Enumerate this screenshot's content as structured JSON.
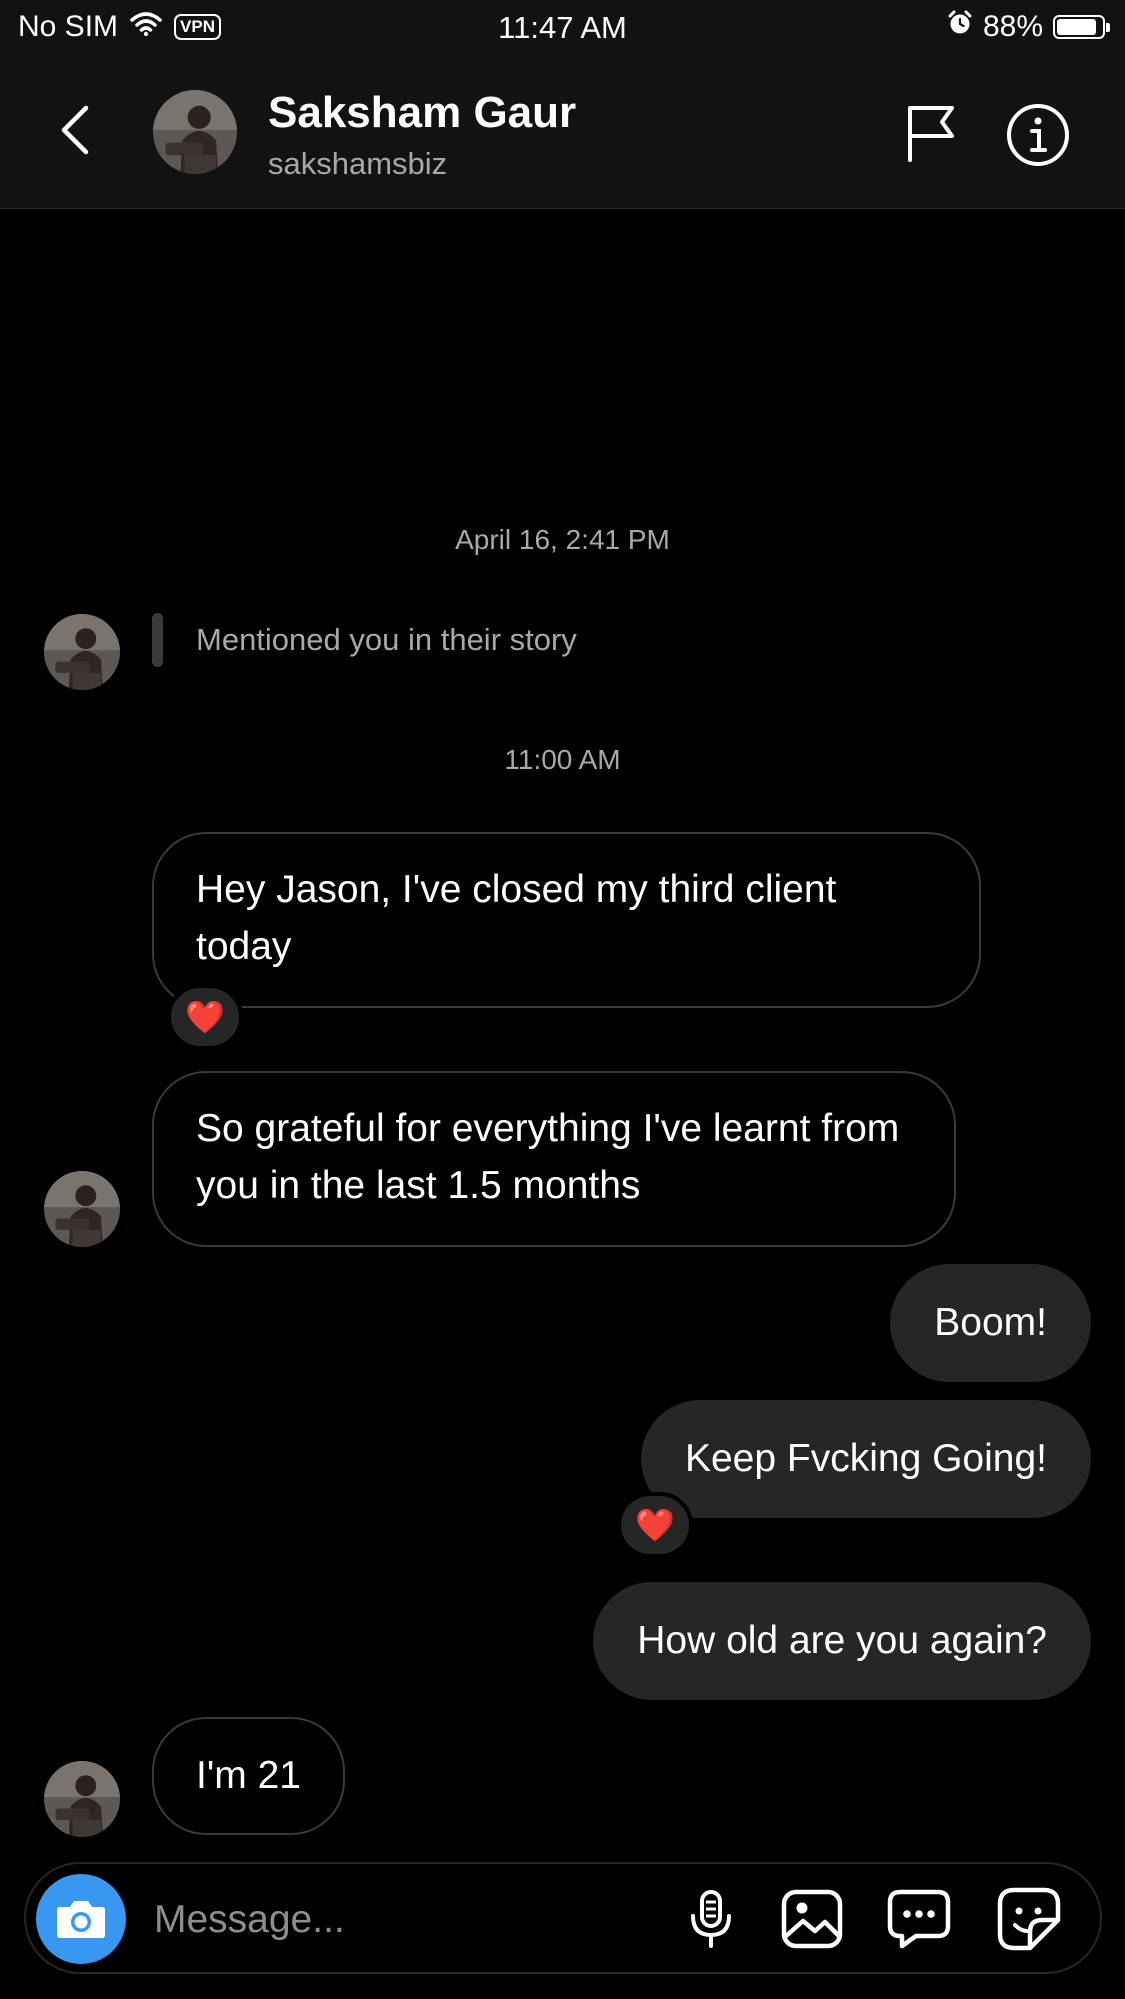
{
  "status_bar": {
    "carrier": "No SIM",
    "vpn": "VPN",
    "time": "11:47 AM",
    "battery_percent": "88%",
    "battery_level": 0.88
  },
  "header": {
    "name": "Saksham Gaur",
    "username": "sakshamsbiz"
  },
  "chat": {
    "timestamp_1": "April 16, 2:41 PM",
    "mention": "Mentioned you in their story",
    "timestamp_2": "11:00 AM",
    "messages": [
      {
        "sender": "them",
        "text": "Hey Jason, I've closed my third client today",
        "reaction": "❤️"
      },
      {
        "sender": "them",
        "text": "So grateful for everything I've learnt from you in the last 1.5 months"
      },
      {
        "sender": "me",
        "text": "Boom!"
      },
      {
        "sender": "me",
        "text": "Keep Fvcking Going!",
        "reaction": "❤️"
      },
      {
        "sender": "me",
        "text": "How old are you again?"
      },
      {
        "sender": "them",
        "text": "I'm 21"
      }
    ]
  },
  "composer": {
    "placeholder": "Message..."
  },
  "colors": {
    "background": "#000000",
    "header": "#121212",
    "sent_bubble": "#262626",
    "received_border": "#3a3a3a",
    "camera_button": "#3897f0",
    "secondary_text": "#a8a8a8"
  },
  "icons": [
    "wifi-icon",
    "alarm-icon",
    "battery-icon",
    "back-icon",
    "flag-icon",
    "info-icon",
    "camera-icon",
    "microphone-icon",
    "gallery-icon",
    "chat-bubble-icon",
    "sticker-icon",
    "heart-icon"
  ]
}
